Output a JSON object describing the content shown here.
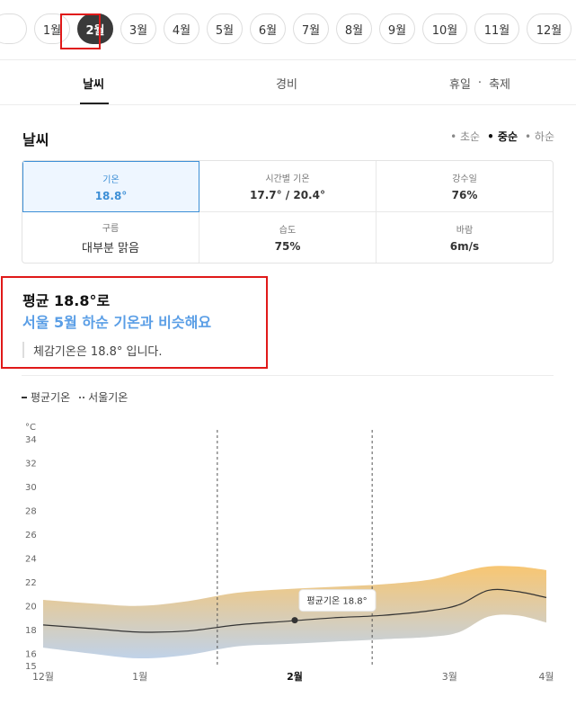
{
  "months": [
    "1월",
    "2월",
    "3월",
    "4월",
    "5월",
    "6월",
    "7월",
    "8월",
    "9월",
    "10월",
    "11월",
    "12월"
  ],
  "selected_month": "2월",
  "tabs": {
    "weather": "날씨",
    "cost": "경비",
    "holiday": "휴일",
    "dot": "·",
    "festival": "축제"
  },
  "section_title": "날씨",
  "period": {
    "early": "• 초순",
    "mid": "• 중순",
    "late": "• 하순"
  },
  "stats": {
    "avg_temp": {
      "label": "기온",
      "value": "18.8°"
    },
    "hourly_temp": {
      "label": "시간별 기온",
      "value": "17.7° / 20.4°"
    },
    "precip": {
      "label": "강수일",
      "value": "76%"
    },
    "cloud": {
      "label": "구름",
      "value": "대부분 맑음"
    },
    "humidity": {
      "label": "습도",
      "value": "75%"
    },
    "wind": {
      "label": "바람",
      "value": "6m/s"
    }
  },
  "summary": {
    "line1": "평균 18.8°로",
    "line2": "서울 5월 하순 기온과 비슷해요",
    "feels_like": "체감기온은 18.8° 입니다."
  },
  "legend": {
    "avg": "평균기온",
    "seoul": "서울기온"
  },
  "colors": {
    "accent": "#5a9ee6",
    "selected": "#3d8fd6",
    "highlight": "#e01919",
    "band_top": "#f7c063",
    "band_bottom": "#b9cde6"
  },
  "chart_data": {
    "type": "area",
    "unit": "°C",
    "ylim": [
      15,
      34
    ],
    "yticks": [
      15,
      16,
      18,
      20,
      22,
      24,
      26,
      28,
      30,
      32,
      34
    ],
    "x_labels": [
      "12월",
      "1월",
      "2월",
      "3월",
      "4월"
    ],
    "x_label_pos": [
      0,
      1.0,
      2.6,
      4.2,
      5.2
    ],
    "current_label": "2월",
    "x": [
      0,
      0.5,
      1.0,
      1.5,
      2.0,
      2.5,
      3.0,
      3.5,
      4.0,
      4.3,
      4.6,
      4.9,
      5.2
    ],
    "avg": [
      18.4,
      18.1,
      17.8,
      17.9,
      18.4,
      18.7,
      19.0,
      19.2,
      19.6,
      20.1,
      21.3,
      21.2,
      20.7
    ],
    "high": [
      20.5,
      20.2,
      20.0,
      20.4,
      21.1,
      21.4,
      21.6,
      21.8,
      22.2,
      22.8,
      23.3,
      23.3,
      23.0
    ],
    "low": [
      16.5,
      16.0,
      15.6,
      15.9,
      16.6,
      16.8,
      17.0,
      17.2,
      17.4,
      17.8,
      19.1,
      19.2,
      18.6
    ],
    "dashed_x": [
      1.8,
      3.4
    ],
    "marker": {
      "x": 2.6,
      "y": 18.8,
      "label": "평균기온 18.8°"
    }
  }
}
